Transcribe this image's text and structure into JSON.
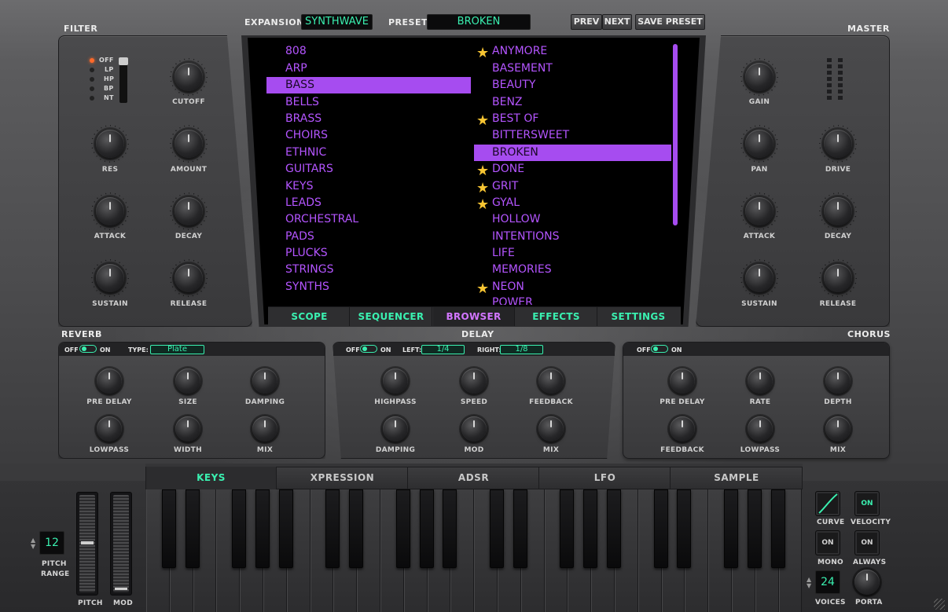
{
  "header": {
    "expansion_label": "EXPANSION",
    "expansion_value": "SYNTHWAVE",
    "preset_label": "PRESET",
    "preset_value": "BROKEN",
    "prev": "PREV",
    "next": "NEXT",
    "save": "SAVE PRESET"
  },
  "filter": {
    "title": "FILTER",
    "types": [
      "OFF",
      "LP",
      "HP",
      "BP",
      "NT"
    ],
    "knobs": [
      "CUTOFF",
      "RES",
      "AMOUNT",
      "ATTACK",
      "DECAY",
      "SUSTAIN",
      "RELEASE"
    ]
  },
  "master": {
    "title": "MASTER",
    "knobs": [
      "GAIN",
      "PAN",
      "DRIVE",
      "ATTACK",
      "DECAY",
      "SUSTAIN",
      "RELEASE"
    ]
  },
  "browser": {
    "categories": [
      "808",
      "ARP",
      "BASS",
      "BELLS",
      "BRASS",
      "CHOIRS",
      "ETHNIC",
      "GUITARS",
      "KEYS",
      "LEADS",
      "ORCHESTRAL",
      "PADS",
      "PLUCKS",
      "STRINGS",
      "SYNTHS"
    ],
    "presets": [
      "ANYMORE",
      "BASEMENT",
      "BEAUTY",
      "BENZ",
      "BEST OF",
      "BITTERSWEET",
      "BROKEN",
      "DONE",
      "GRIT",
      "GYAL",
      "HOLLOW",
      "INTENTIONS",
      "LIFE",
      "MEMORIES",
      "NEON",
      "POWER"
    ],
    "selected_category": "BASS",
    "selected_preset": "BROKEN",
    "starred": [
      "ANYMORE",
      "BEST OF",
      "DONE",
      "GRIT",
      "GYAL",
      "NEON"
    ],
    "tabs": [
      "SCOPE",
      "SEQUENCER",
      "BROWSER",
      "EFFECTS",
      "SETTINGS"
    ],
    "active_tab": "BROWSER"
  },
  "reverb": {
    "title": "REVERB",
    "off": "OFF",
    "on": "ON",
    "type_label": "TYPE:",
    "type_value": "Plate",
    "knobs": [
      "PRE DELAY",
      "SIZE",
      "DAMPING",
      "LOWPASS",
      "WIDTH",
      "MIX"
    ]
  },
  "delay": {
    "title": "DELAY",
    "off": "OFF",
    "on": "ON",
    "left_label": "LEFT:",
    "left_value": "1/4",
    "right_label": "RIGHT:",
    "right_value": "1/8",
    "knobs": [
      "HIGHPASS",
      "SPEED",
      "FEEDBACK",
      "DAMPING",
      "MOD",
      "MIX"
    ]
  },
  "chorus": {
    "title": "CHORUS",
    "off": "OFF",
    "on": "ON",
    "knobs": [
      "PRE DELAY",
      "RATE",
      "DEPTH",
      "FEEDBACK",
      "LOWPASS",
      "MIX"
    ]
  },
  "keys_tabs": [
    "KEYS",
    "XPRESSION",
    "ADSR",
    "LFO",
    "SAMPLE"
  ],
  "left": {
    "pitch_range_value": "12",
    "pitch_range_label1": "PITCH",
    "pitch_range_label2": "RANGE",
    "pitch": "PITCH",
    "mod": "MOD"
  },
  "right": {
    "curve": "CURVE",
    "velocity": "VELOCITY",
    "velocity_state": "ON",
    "mono": "MONO",
    "mono_state": "ON",
    "always": "ALWAYS",
    "always_state": "ON",
    "voices_value": "24",
    "voices": "VOICES",
    "porta": "PORTA"
  },
  "colors": {
    "accent": "#3af0b0",
    "purple": "#b455ff",
    "selected": "#a64cf0",
    "star": "#f7c532"
  }
}
